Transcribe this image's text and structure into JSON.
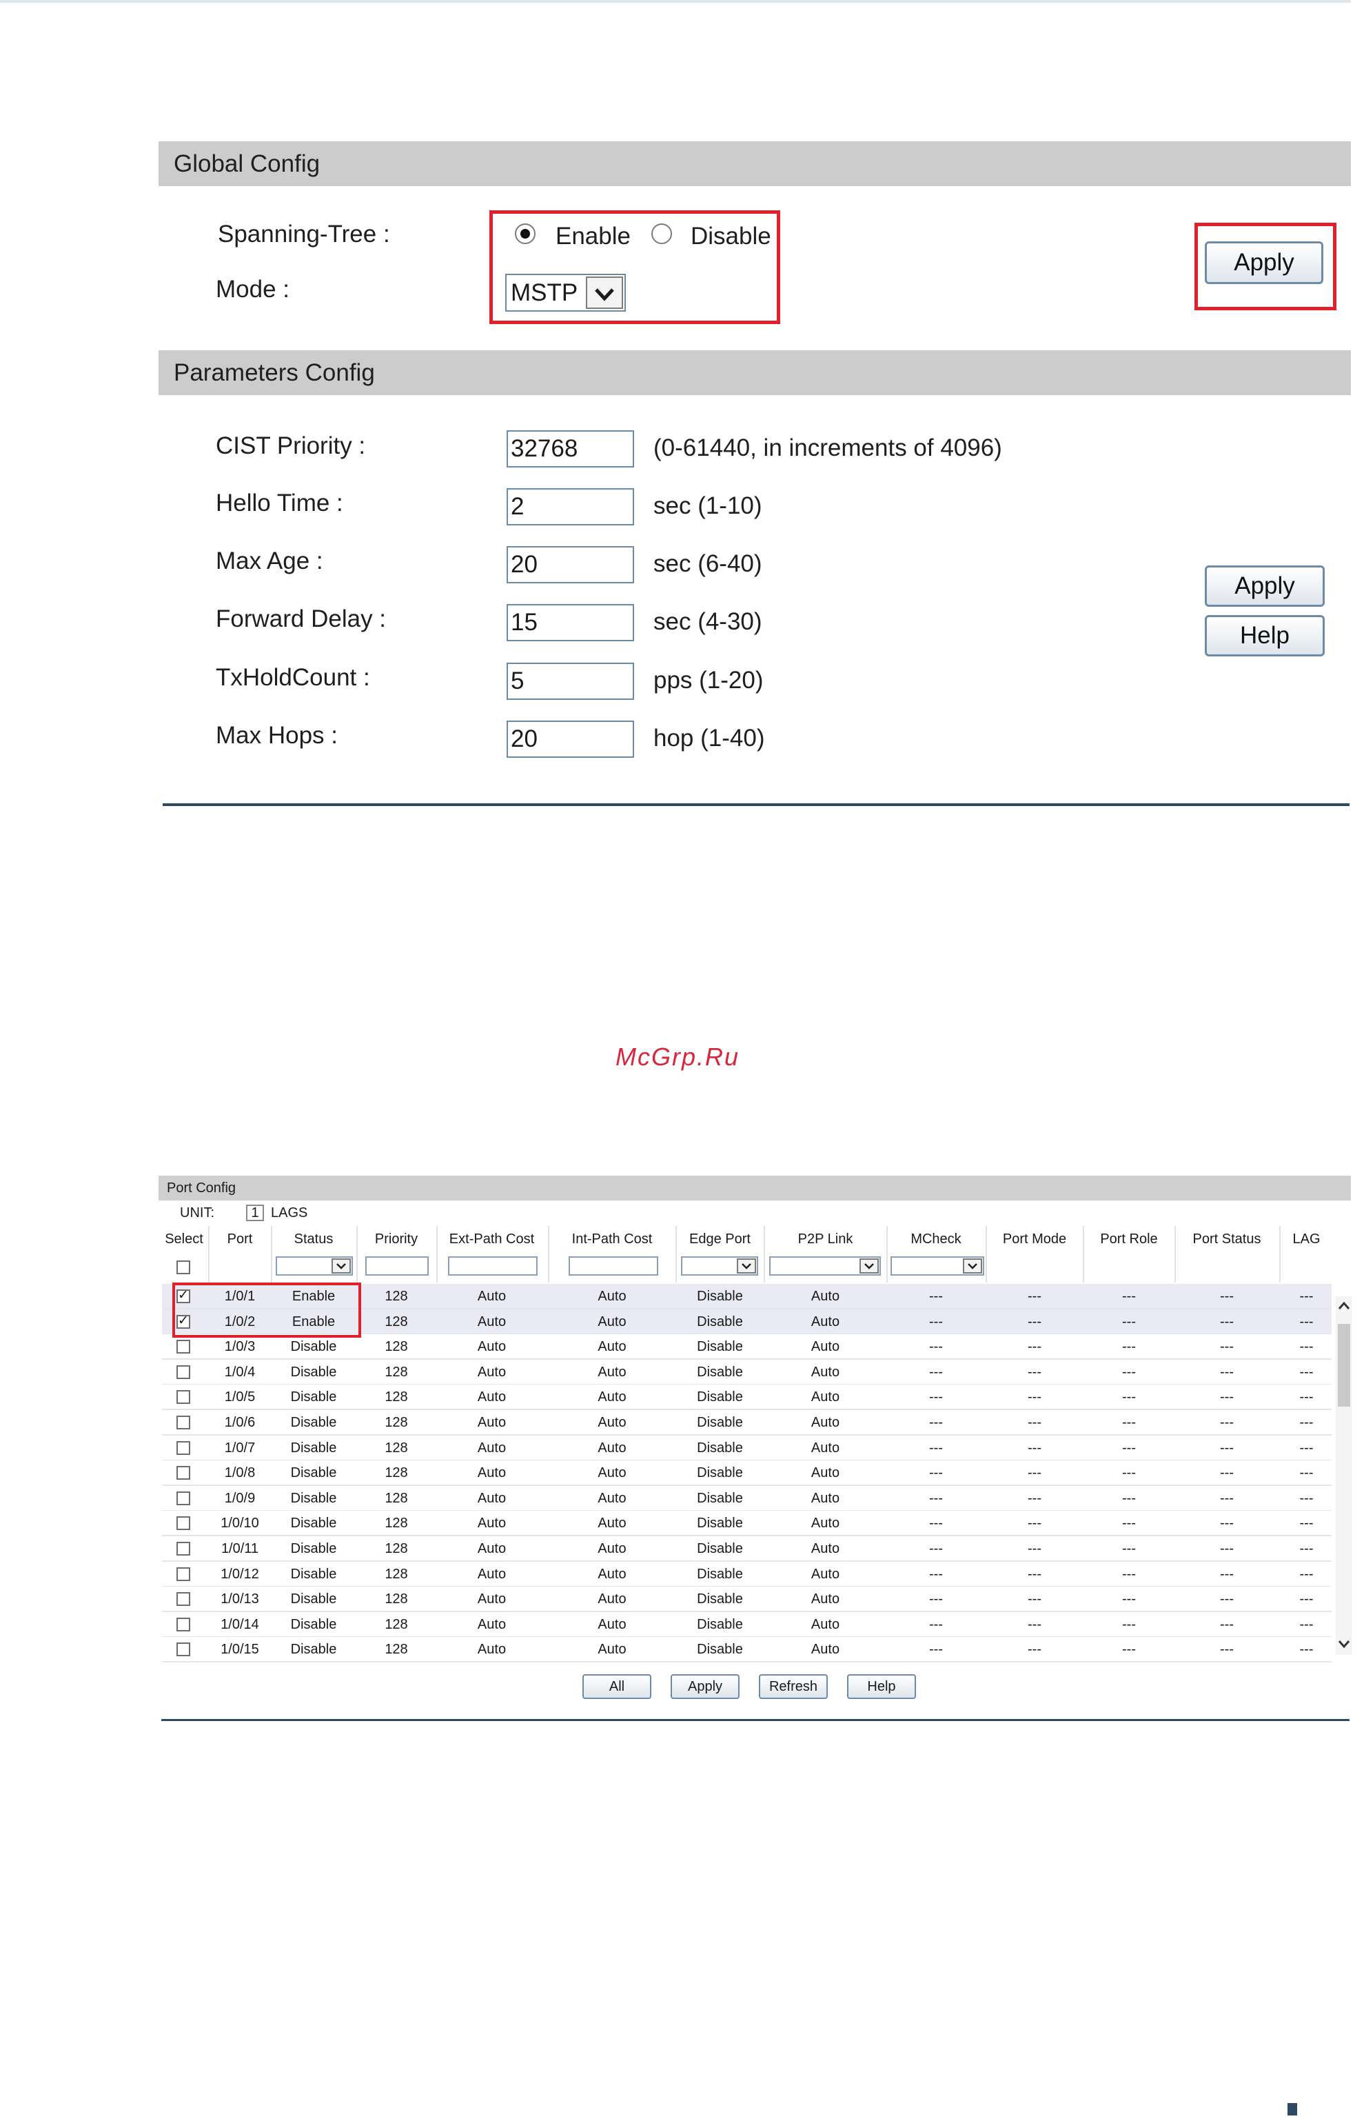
{
  "global_config": {
    "header": "Global Config",
    "spanning_tree_label": "Spanning-Tree :",
    "enable_label": "Enable",
    "disable_label": "Disable",
    "spanning_tree_value": "Enable",
    "mode_label": "Mode :",
    "mode_value": "MSTP",
    "apply_label": "Apply"
  },
  "parameters_config": {
    "header": "Parameters Config",
    "fields": [
      {
        "label": "CIST Priority :",
        "value": "32768",
        "note": "(0-61440, in increments of 4096)"
      },
      {
        "label": "Hello Time :",
        "value": "2",
        "note": "sec (1-10)"
      },
      {
        "label": "Max Age :",
        "value": "20",
        "note": "sec (6-40)"
      },
      {
        "label": "Forward Delay :",
        "value": "15",
        "note": "sec (4-30)"
      },
      {
        "label": "TxHoldCount :",
        "value": "5",
        "note": "pps (1-20)"
      },
      {
        "label": "Max Hops :",
        "value": "20",
        "note": "hop (1-40)"
      }
    ],
    "apply_label": "Apply",
    "help_label": "Help"
  },
  "watermark": "McGrp.Ru",
  "port_config": {
    "header": "Port Config",
    "unit_label": "UNIT:",
    "unit_value": "1",
    "lags_label": "LAGS",
    "columns": [
      "Select",
      "Port",
      "Status",
      "Priority",
      "Ext-Path Cost",
      "Int-Path Cost",
      "Edge Port",
      "P2P Link",
      "MCheck",
      "Port Mode",
      "Port Role",
      "Port Status",
      "LAG"
    ],
    "rows": [
      {
        "selected": true,
        "port": "1/0/1",
        "status": "Enable",
        "priority": "128",
        "ext": "Auto",
        "int": "Auto",
        "edge": "Disable",
        "p2p": "Auto",
        "mcheck": "---",
        "mode": "---",
        "role": "---",
        "pstatus": "---",
        "lag": "---"
      },
      {
        "selected": true,
        "port": "1/0/2",
        "status": "Enable",
        "priority": "128",
        "ext": "Auto",
        "int": "Auto",
        "edge": "Disable",
        "p2p": "Auto",
        "mcheck": "---",
        "mode": "---",
        "role": "---",
        "pstatus": "---",
        "lag": "---"
      },
      {
        "selected": false,
        "port": "1/0/3",
        "status": "Disable",
        "priority": "128",
        "ext": "Auto",
        "int": "Auto",
        "edge": "Disable",
        "p2p": "Auto",
        "mcheck": "---",
        "mode": "---",
        "role": "---",
        "pstatus": "---",
        "lag": "---"
      },
      {
        "selected": false,
        "port": "1/0/4",
        "status": "Disable",
        "priority": "128",
        "ext": "Auto",
        "int": "Auto",
        "edge": "Disable",
        "p2p": "Auto",
        "mcheck": "---",
        "mode": "---",
        "role": "---",
        "pstatus": "---",
        "lag": "---"
      },
      {
        "selected": false,
        "port": "1/0/5",
        "status": "Disable",
        "priority": "128",
        "ext": "Auto",
        "int": "Auto",
        "edge": "Disable",
        "p2p": "Auto",
        "mcheck": "---",
        "mode": "---",
        "role": "---",
        "pstatus": "---",
        "lag": "---"
      },
      {
        "selected": false,
        "port": "1/0/6",
        "status": "Disable",
        "priority": "128",
        "ext": "Auto",
        "int": "Auto",
        "edge": "Disable",
        "p2p": "Auto",
        "mcheck": "---",
        "mode": "---",
        "role": "---",
        "pstatus": "---",
        "lag": "---"
      },
      {
        "selected": false,
        "port": "1/0/7",
        "status": "Disable",
        "priority": "128",
        "ext": "Auto",
        "int": "Auto",
        "edge": "Disable",
        "p2p": "Auto",
        "mcheck": "---",
        "mode": "---",
        "role": "---",
        "pstatus": "---",
        "lag": "---"
      },
      {
        "selected": false,
        "port": "1/0/8",
        "status": "Disable",
        "priority": "128",
        "ext": "Auto",
        "int": "Auto",
        "edge": "Disable",
        "p2p": "Auto",
        "mcheck": "---",
        "mode": "---",
        "role": "---",
        "pstatus": "---",
        "lag": "---"
      },
      {
        "selected": false,
        "port": "1/0/9",
        "status": "Disable",
        "priority": "128",
        "ext": "Auto",
        "int": "Auto",
        "edge": "Disable",
        "p2p": "Auto",
        "mcheck": "---",
        "mode": "---",
        "role": "---",
        "pstatus": "---",
        "lag": "---"
      },
      {
        "selected": false,
        "port": "1/0/10",
        "status": "Disable",
        "priority": "128",
        "ext": "Auto",
        "int": "Auto",
        "edge": "Disable",
        "p2p": "Auto",
        "mcheck": "---",
        "mode": "---",
        "role": "---",
        "pstatus": "---",
        "lag": "---"
      },
      {
        "selected": false,
        "port": "1/0/11",
        "status": "Disable",
        "priority": "128",
        "ext": "Auto",
        "int": "Auto",
        "edge": "Disable",
        "p2p": "Auto",
        "mcheck": "---",
        "mode": "---",
        "role": "---",
        "pstatus": "---",
        "lag": "---"
      },
      {
        "selected": false,
        "port": "1/0/12",
        "status": "Disable",
        "priority": "128",
        "ext": "Auto",
        "int": "Auto",
        "edge": "Disable",
        "p2p": "Auto",
        "mcheck": "---",
        "mode": "---",
        "role": "---",
        "pstatus": "---",
        "lag": "---"
      },
      {
        "selected": false,
        "port": "1/0/13",
        "status": "Disable",
        "priority": "128",
        "ext": "Auto",
        "int": "Auto",
        "edge": "Disable",
        "p2p": "Auto",
        "mcheck": "---",
        "mode": "---",
        "role": "---",
        "pstatus": "---",
        "lag": "---"
      },
      {
        "selected": false,
        "port": "1/0/14",
        "status": "Disable",
        "priority": "128",
        "ext": "Auto",
        "int": "Auto",
        "edge": "Disable",
        "p2p": "Auto",
        "mcheck": "---",
        "mode": "---",
        "role": "---",
        "pstatus": "---",
        "lag": "---"
      },
      {
        "selected": false,
        "port": "1/0/15",
        "status": "Disable",
        "priority": "128",
        "ext": "Auto",
        "int": "Auto",
        "edge": "Disable",
        "p2p": "Auto",
        "mcheck": "---",
        "mode": "---",
        "role": "---",
        "pstatus": "---",
        "lag": "---"
      }
    ],
    "buttons": {
      "all": "All",
      "apply": "Apply",
      "refresh": "Refresh",
      "help": "Help"
    }
  },
  "colors": {
    "highlight_box": "#e0202a",
    "header_bg": "#cccccc",
    "rule": "#2e4a63",
    "selected_row": "#e9eaf4"
  }
}
